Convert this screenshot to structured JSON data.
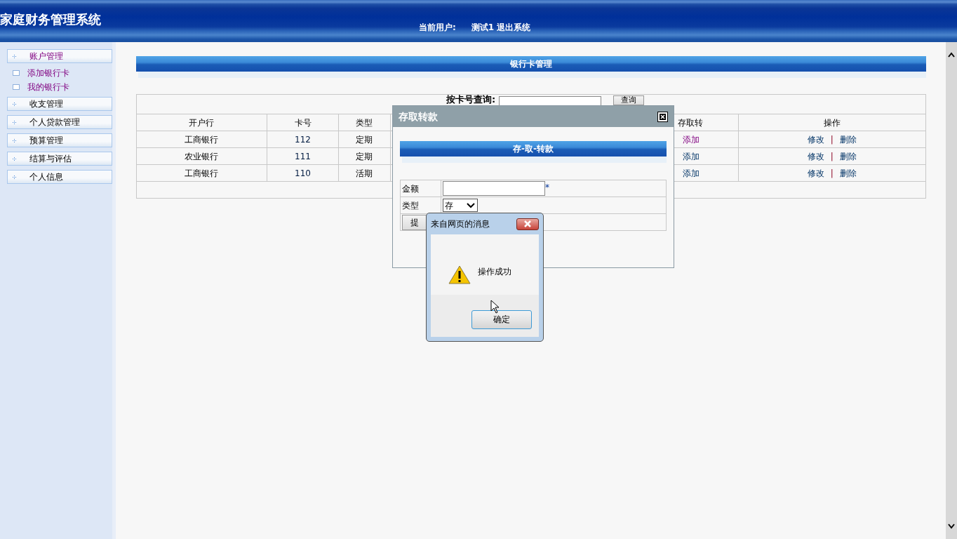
{
  "header": {
    "title": "家庭财务管理系统",
    "user_label": "当前用户:",
    "user_name": "测试1",
    "logout": "退出系统"
  },
  "sidebar": {
    "items": [
      {
        "label": "账户管理",
        "visited": true,
        "children": [
          {
            "label": "添加银行卡",
            "visited": true
          },
          {
            "label": "我的银行卡",
            "visited": true
          }
        ]
      },
      {
        "label": "收支管理",
        "visited": false
      },
      {
        "label": "个人贷款管理",
        "visited": false
      },
      {
        "label": "预算管理",
        "visited": false
      },
      {
        "label": "结算与评估",
        "visited": false
      },
      {
        "label": "个人信息",
        "visited": false
      }
    ]
  },
  "panel_title": "银行卡管理",
  "search": {
    "label": "按卡号查询:",
    "button": "查询"
  },
  "table": {
    "columns": [
      "开户行",
      "卡号",
      "类型",
      "存取转",
      "操作"
    ],
    "rows": [
      {
        "bank": "工商银行",
        "card": "112",
        "type": "定期",
        "action": "添加",
        "action_visited": true,
        "edit": "修改",
        "separator": "|",
        "delete": "删除"
      },
      {
        "bank": "农业银行",
        "card": "111",
        "type": "定期",
        "action": "添加",
        "action_visited": false,
        "edit": "修改",
        "separator": "|",
        "delete": "删除"
      },
      {
        "bank": "工商银行",
        "card": "110",
        "type": "活期",
        "action": "添加",
        "action_visited": false,
        "edit": "修改",
        "separator": "|",
        "delete": "删除"
      }
    ]
  },
  "modal": {
    "title": "存取转款",
    "heading": "存-取-转款",
    "fields": [
      {
        "kind": "input",
        "label": "金额",
        "required_mark": "*"
      },
      {
        "kind": "select",
        "label": "类型",
        "value": "存"
      }
    ],
    "submit": "提"
  },
  "alert": {
    "title": "来自网页的消息",
    "message": "操作成功",
    "button": "确定"
  }
}
